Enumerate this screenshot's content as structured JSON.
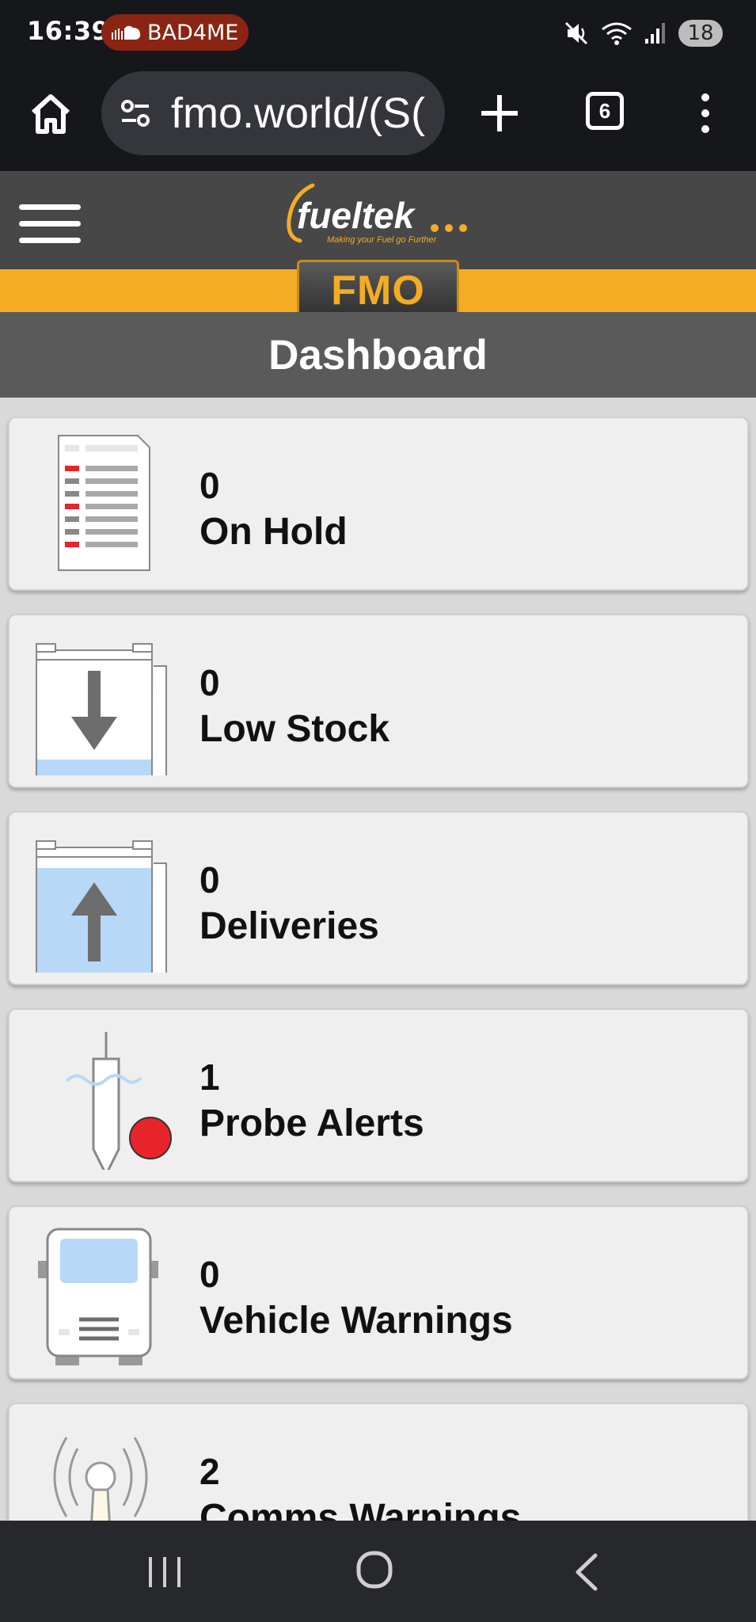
{
  "status_bar": {
    "time": "16:39",
    "notification_label": "BAD4ME",
    "battery_level": "18",
    "icons": [
      "sound-icon",
      "mute-icon",
      "wifi-icon",
      "signal-icon",
      "battery-icon"
    ]
  },
  "browser": {
    "url": "fmo.world/(S(",
    "tab_count": "6",
    "icons": [
      "home-icon",
      "site-settings-icon",
      "new-tab-icon",
      "tabs-icon",
      "menu-kebab-icon"
    ]
  },
  "app": {
    "brand_name": "fueltek",
    "brand_tagline": "Making your Fuel go Further",
    "badge": "FMO",
    "page_title": "Dashboard",
    "accent_color": "#f4ac25",
    "header_color": "#474747"
  },
  "cards": [
    {
      "count": "0",
      "label": "On Hold",
      "icon": "on-hold-document-icon"
    },
    {
      "count": "0",
      "label": "Low Stock",
      "icon": "low-stock-tank-icon"
    },
    {
      "count": "0",
      "label": "Deliveries",
      "icon": "delivery-tank-icon"
    },
    {
      "count": "1",
      "label": "Probe Alerts",
      "icon": "probe-alert-icon"
    },
    {
      "count": "0",
      "label": "Vehicle Warnings",
      "icon": "vehicle-icon"
    },
    {
      "count": "2",
      "label": "Comms Warnings",
      "icon": "comms-antenna-icon"
    }
  ],
  "nav": {
    "icons": [
      "recents-icon",
      "home-circle-icon",
      "back-icon"
    ]
  }
}
